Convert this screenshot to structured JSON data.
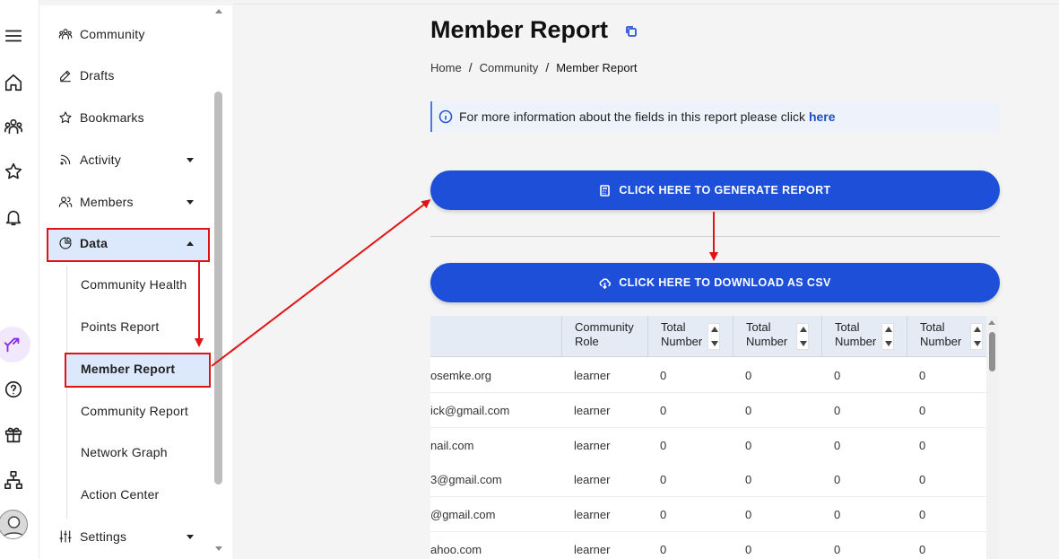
{
  "rail": {
    "icons": [
      "menu-icon",
      "home-icon",
      "community-icon",
      "star-icon",
      "bell-icon",
      "branch-icon",
      "help-icon",
      "gift-icon",
      "network-icon",
      "avatar"
    ]
  },
  "sidebar": {
    "items": [
      {
        "label": "Community",
        "icon": "community-icon"
      },
      {
        "label": "Drafts",
        "icon": "pencil-icon"
      },
      {
        "label": "Bookmarks",
        "icon": "star-icon"
      },
      {
        "label": "Activity",
        "icon": "rss-icon"
      },
      {
        "label": "Members",
        "icon": "members-icon"
      },
      {
        "label": "Data",
        "icon": "pie-chart-icon"
      },
      {
        "label": "Settings",
        "icon": "sliders-icon"
      }
    ],
    "sub_items": [
      {
        "label": "Community Health"
      },
      {
        "label": "Points Report"
      },
      {
        "label": "Member Report"
      },
      {
        "label": "Community Report"
      },
      {
        "label": "Network Graph"
      },
      {
        "label": "Action Center"
      }
    ]
  },
  "main": {
    "title": "Member Report",
    "breadcrumb": [
      {
        "label": "Home"
      },
      {
        "label": "Community"
      },
      {
        "label": "Member Report"
      }
    ],
    "separator": "/",
    "info_text": "For more information about the fields in this report please click",
    "info_link": "here",
    "generate_button": "CLICK HERE TO GENERATE REPORT",
    "download_button": "CLICK HERE TO DOWNLOAD AS CSV"
  },
  "table": {
    "headers": [
      {
        "label": ""
      },
      {
        "label": "Community Role"
      },
      {
        "label": "Total Number"
      },
      {
        "label": "Total Number"
      },
      {
        "label": "Total Number"
      },
      {
        "label": "Total Number"
      }
    ],
    "rows": [
      [
        "osemke.org",
        "learner",
        "0",
        "0",
        "0",
        "0"
      ],
      [
        "ick@gmail.com",
        "learner",
        "0",
        "0",
        "0",
        "0"
      ],
      [
        "nail.com",
        "learner",
        "0",
        "0",
        "0",
        "0"
      ],
      [
        "3@gmail.com",
        "learner",
        "0",
        "0",
        "0",
        "0"
      ],
      [
        "@gmail.com",
        "learner",
        "0",
        "0",
        "0",
        "0"
      ],
      [
        "ahoo.com",
        "learner",
        "0",
        "0",
        "0",
        "0"
      ]
    ]
  },
  "colors": {
    "accent": "#1d4fd8",
    "annotation": "#e01414",
    "active_bg": "#dce8fb"
  }
}
